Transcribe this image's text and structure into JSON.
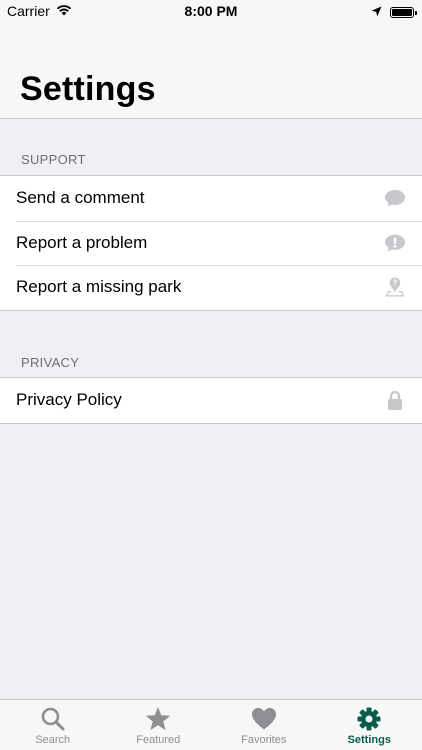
{
  "status_bar": {
    "carrier": "Carrier",
    "time": "8:00 PM"
  },
  "header": {
    "title": "Settings"
  },
  "sections": [
    {
      "title": "SUPPORT",
      "items": [
        {
          "label": "Send a comment",
          "icon": "speech-bubble-icon"
        },
        {
          "label": "Report a problem",
          "icon": "exclamation-bubble-icon"
        },
        {
          "label": "Report a missing park",
          "icon": "map-question-pin-icon"
        }
      ]
    },
    {
      "title": "PRIVACY",
      "items": [
        {
          "label": "Privacy Policy",
          "icon": "lock-icon"
        }
      ]
    }
  ],
  "tab_bar": {
    "tabs": [
      {
        "label": "Search",
        "icon": "search-icon"
      },
      {
        "label": "Featured",
        "icon": "star-icon"
      },
      {
        "label": "Favorites",
        "icon": "heart-icon"
      },
      {
        "label": "Settings",
        "icon": "gear-icon",
        "active": true
      }
    ]
  },
  "colors": {
    "accent": "#0b5d4b",
    "inactive_tab": "#8e8e93",
    "background": "#efeff4",
    "row_icon": "#c7c7cc"
  }
}
